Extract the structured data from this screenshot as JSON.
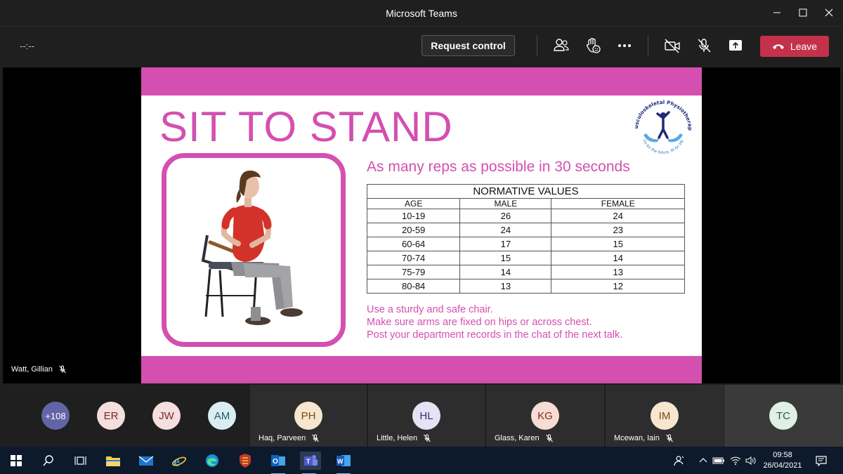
{
  "window": {
    "title": "Microsoft Teams"
  },
  "toolbar": {
    "timer": "--:--",
    "request_control_label": "Request control",
    "leave_label": "Leave"
  },
  "stage": {
    "presenter_name": "Watt, Gillian"
  },
  "slide": {
    "title": "SIT TO STAND",
    "subtitle": "As many reps as possible in 30 seconds",
    "logo_text_top": "Musculoskeletal Physiotherapy",
    "logo_text_bottom": "Fit for the future, fit for life",
    "table": {
      "caption": "NORMATIVE VALUES",
      "headers": [
        "AGE",
        "MALE",
        "FEMALE"
      ],
      "rows": [
        [
          "10-19",
          "26",
          "24"
        ],
        [
          "20-59",
          "24",
          "23"
        ],
        [
          "60-64",
          "17",
          "15"
        ],
        [
          "70-74",
          "15",
          "14"
        ],
        [
          "75-79",
          "14",
          "13"
        ],
        [
          "80-84",
          "13",
          "12"
        ]
      ]
    },
    "notes": [
      "Use a sturdy and safe chair.",
      "Make sure arms are fixed on hips or across chest.",
      "Post your department records in the chat of the next talk."
    ],
    "accent_color": "#d44fb0"
  },
  "gallery": {
    "overflow": {
      "initials": "+108"
    },
    "avatars": [
      {
        "initials": "ER"
      },
      {
        "initials": "JW"
      },
      {
        "initials": "AM"
      }
    ],
    "tiles": [
      {
        "initials": "PH",
        "name": "Haq, Parveen"
      },
      {
        "initials": "HL",
        "name": "Little, Helen"
      },
      {
        "initials": "KG",
        "name": "Glass, Karen"
      },
      {
        "initials": "IM",
        "name": "Mcewan, Iain"
      },
      {
        "initials": "TC",
        "name": ""
      }
    ]
  },
  "taskbar": {
    "time": "09:58",
    "date": "26/04/2021"
  },
  "colors": {
    "leave": "#c4314b",
    "taskbar": "#0c1a2b",
    "overflow_avatar": "#6264a7"
  }
}
